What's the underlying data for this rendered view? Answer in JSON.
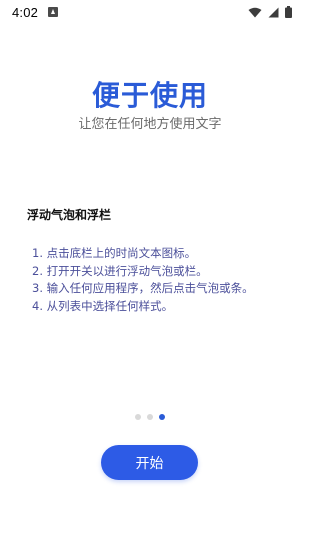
{
  "status_bar": {
    "time": "4:02",
    "icons": [
      "notification-icon",
      "wifi-icon",
      "signal-icon",
      "battery-icon"
    ]
  },
  "title": "便于使用",
  "subtitle": "让您在任何地方使用文字",
  "feature_heading": "浮动气泡和浮栏",
  "steps": [
    "1. 点击底栏上的时尚文本图标。",
    "2. 打开开关以进行浮动气泡或栏。",
    "3. 输入任何应用程序，然后点击气泡或条。",
    "4. 从列表中选择任何样式。"
  ],
  "pager": {
    "total": 3,
    "active_index": 2
  },
  "start_button_label": "开始",
  "colors": {
    "accent": "#2a5bd7",
    "button": "#2d5be6",
    "step_text": "#4b4f9a",
    "dot_inactive": "#d9d9d9"
  }
}
